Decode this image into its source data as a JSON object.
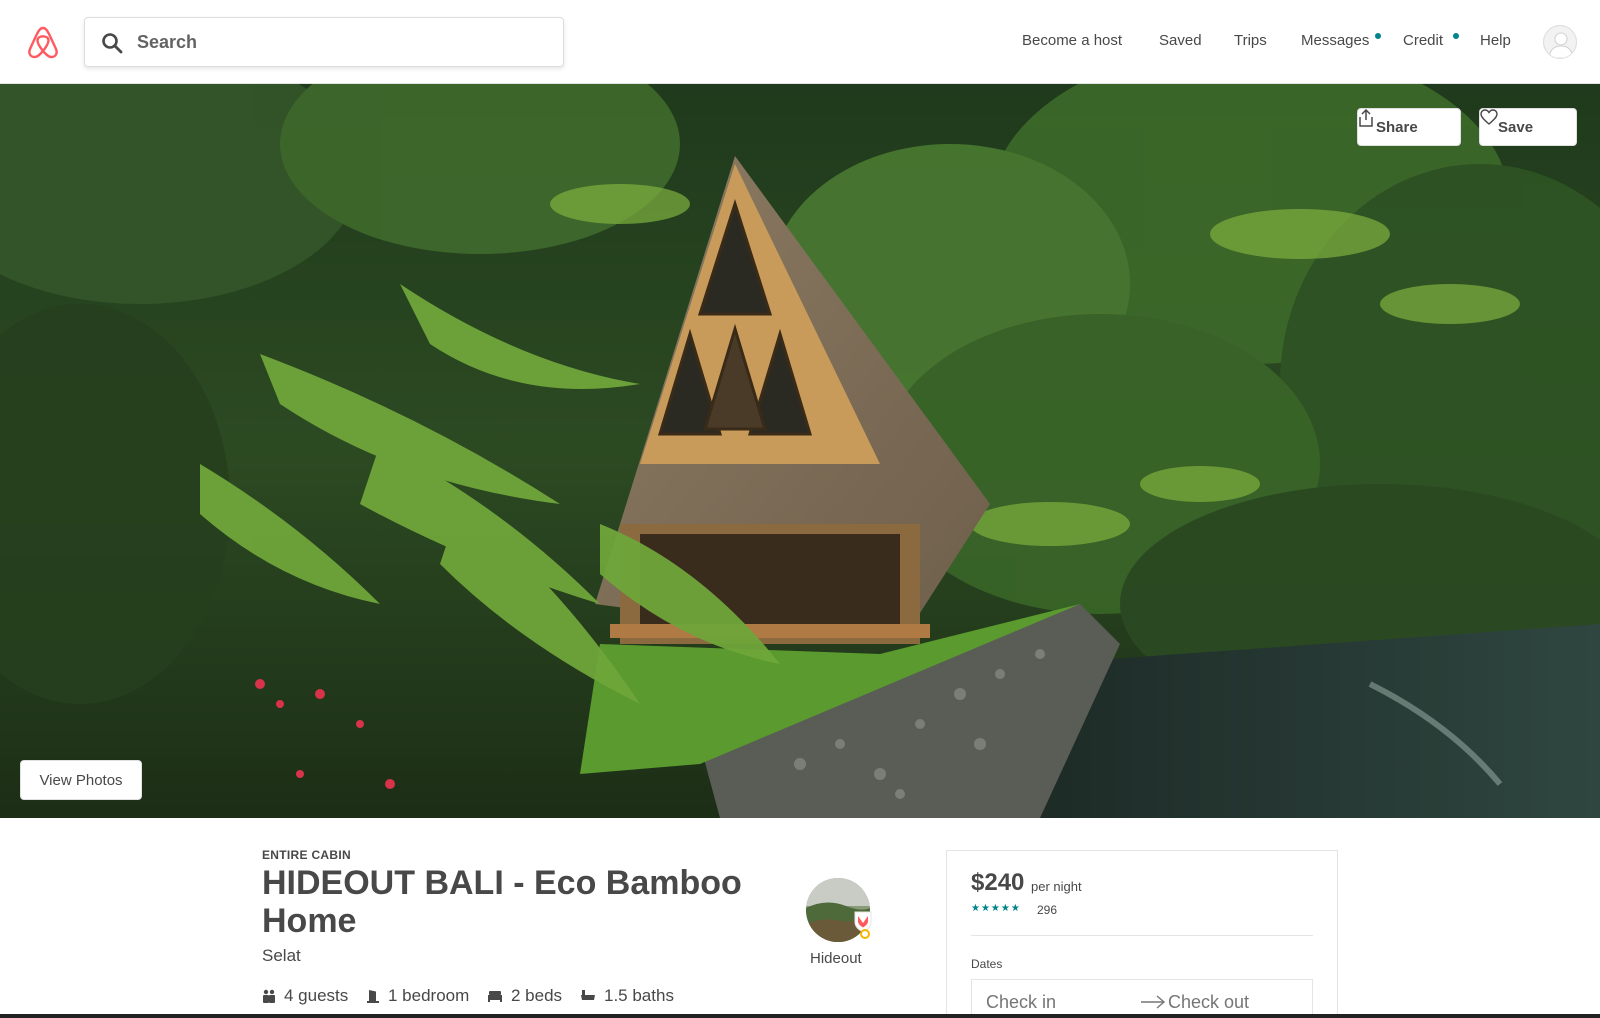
{
  "header": {
    "logo_icon": "airbnb-belo-icon",
    "search": {
      "placeholder": "Search",
      "icon": "search-icon"
    },
    "nav": {
      "become_host": "Become a host",
      "saved": "Saved",
      "trips": "Trips",
      "messages": "Messages",
      "credit": "Credit",
      "help": "Help"
    },
    "notification_color": "#008489",
    "brand_color": "#FF5A5F"
  },
  "hero": {
    "share_label": "Share",
    "save_label": "Save",
    "view_photos_label": "View Photos"
  },
  "listing": {
    "kind": "ENTIRE CABIN",
    "title": "HIDEOUT BALI - Eco Bamboo Home",
    "city": "Selat",
    "amenities": {
      "guests": "4 guests",
      "bedrooms": "1 bedroom",
      "beds": "2 beds",
      "baths": "1.5 baths"
    },
    "host_name": "Hideout"
  },
  "booking": {
    "price": "$240",
    "per_night": "per night",
    "stars": "★★★★★",
    "rating": 5,
    "review_count": "296",
    "dates_label": "Dates",
    "check_in": "Check in",
    "check_out": "Check out"
  }
}
